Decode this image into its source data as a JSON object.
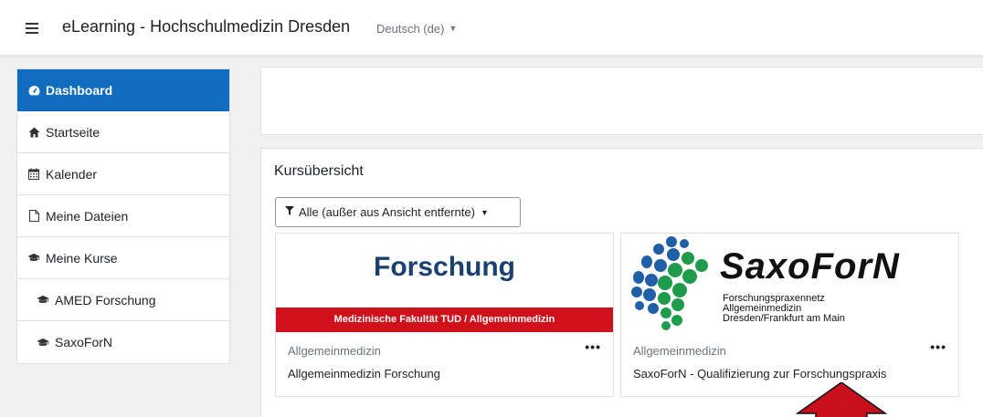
{
  "header": {
    "menu_icon": "hamburger-icon",
    "site_title": "eLearning - Hochschulmedizin Dresden",
    "language": "Deutsch (de)"
  },
  "sidebar": {
    "items": [
      {
        "label": "Dashboard",
        "icon": "dashboard-icon",
        "active": true
      },
      {
        "label": "Startseite",
        "icon": "home-icon"
      },
      {
        "label": "Kalender",
        "icon": "calendar-icon"
      },
      {
        "label": "Meine Dateien",
        "icon": "file-icon"
      },
      {
        "label": "Meine Kurse",
        "icon": "graduation-cap-icon"
      },
      {
        "label": "AMED Forschung",
        "icon": "graduation-cap-icon"
      },
      {
        "label": "SaxoForN",
        "icon": "graduation-cap-icon"
      }
    ]
  },
  "courses": {
    "title": "Kursübersicht",
    "filter_label": "Alle (außer aus Ansicht entfernte)",
    "cards": [
      {
        "image_title": "Forschung",
        "image_band": "Medizinische Fakultät TUD / Allgemeinmedizin",
        "category": "Allgemeinmedizin",
        "name": "Allgemeinmedizin Forschung",
        "menu": "•••"
      },
      {
        "image_title": "SaxoForN",
        "image_sub": [
          "Forschungspraxennetz",
          "Allgemeinmedizin",
          "Dresden/Frankfurt am Main"
        ],
        "category": "Allgemeinmedizin",
        "name": "SaxoForN - Qualifizierung zur Forschungspraxis",
        "menu": "•••"
      }
    ]
  },
  "colors": {
    "primary": "#0f6cbf",
    "band_red": "#d0101a",
    "logo_blue": "#1f5fa8",
    "logo_green": "#1e9b4b",
    "arrow_red": "#c8101a"
  }
}
